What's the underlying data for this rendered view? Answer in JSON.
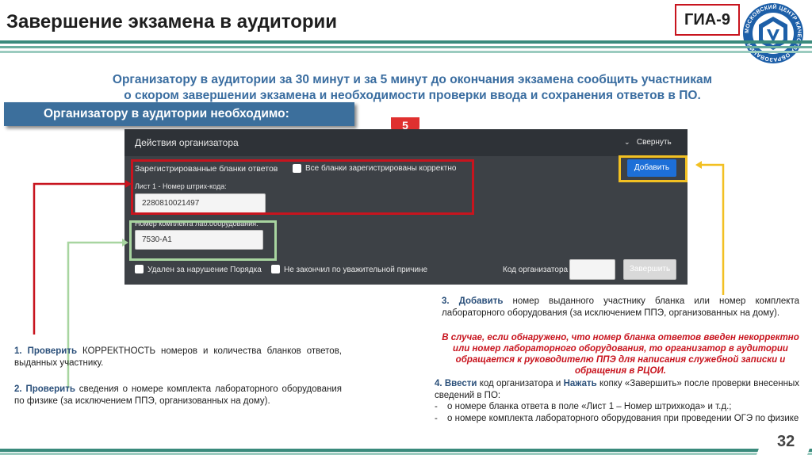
{
  "header": {
    "title": "Завершение экзамена в аудитории",
    "badge": "ГИА-9",
    "logo_text": "МОСКОВСКИЙ ЦЕНТР КАЧЕСТВА ОБРАЗОВАНИЯ"
  },
  "intro": {
    "line1": "Организатору в аудитории за 30 минут и за 5 минут до окончания экзамена сообщить участникам",
    "line2": "о скором завершении экзамена и необходимости проверки ввода и сохранения ответов в ПО."
  },
  "banner": "Организатору в аудитории необходимо:",
  "marker_number": "5",
  "panel": {
    "title": "Действия организатора",
    "collapse_label": "Свернуть",
    "section_label": "Зарегистрированные бланки ответов",
    "all_registered_label": "Все бланки зарегистрированы корректно",
    "sheet_label": "Лист 1 - Номер штрих-кода:",
    "sheet_value": "2280810021497",
    "kit_label": "Номер комплекта лаб.оборудования:",
    "kit_value": "7530-A1",
    "add_button": "Добавить",
    "removed_label": "Удален за нарушение Порядка",
    "not_finished_label": "Не закончил по уважительной причине",
    "organizer_code_label": "Код организатора",
    "finish_button": "Завершить"
  },
  "steps": {
    "s1_num": "1.",
    "s1_verb": "Проверить",
    "s1_text": "КОРРЕКТНОСТЬ номеров и количества бланков ответов, выданных участнику.",
    "s2_num": "2.",
    "s2_verb": "Проверить",
    "s2_text": "сведения о номере комплекта лабораторного оборудования по физике (за исключением ППЭ, организованных на дому).",
    "s3_num": "3.",
    "s3_verb": "Добавить",
    "s3_text": "номер выданного участнику бланка или номер комплекта лабораторного оборудования (за исключением ППЭ, организованных на дому).",
    "s3_note": "В случае, если обнаружено, что номер бланка ответов введен некорректно или номер лабораторного оборудования, то организатор в аудитории обращается к руководителю ППЭ для написания служебной записки и обращения в РЦОИ.",
    "s4_num": "4.",
    "s4_verb1": "Ввести",
    "s4_mid": "код организатора и",
    "s4_verb2": "Нажать",
    "s4_text": "копку «Завершить» после проверки внесенных сведений в ПО:",
    "s4_item1": "о номере бланка ответа в поле «Лист 1 – Номер штрихкода» и т.д.;",
    "s4_item2": "о номере комплекта лабораторного оборудования при проведении ОГЭ по физике"
  },
  "page_number": "32",
  "colors": {
    "accent_teal": "#3a8a7c",
    "banner_blue": "#3c6f9c",
    "red": "#c8141e",
    "yellow": "#f2c022",
    "green": "#a8d5a0",
    "button_blue": "#1d6fd8"
  }
}
